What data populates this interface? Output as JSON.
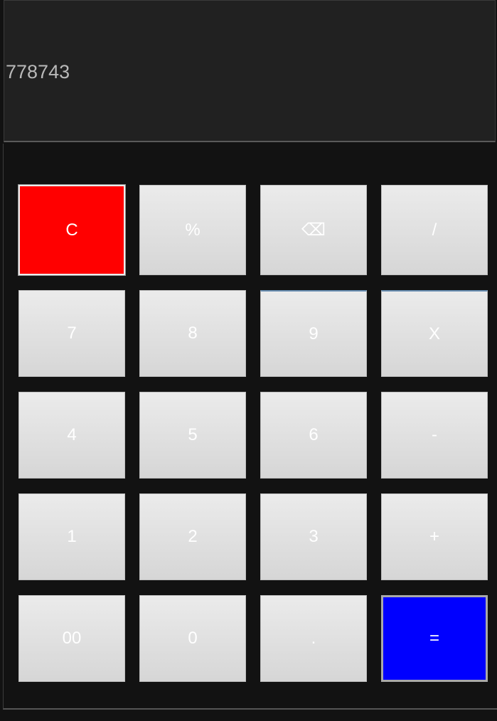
{
  "display": {
    "value": "778743"
  },
  "keys": {
    "clear": "C",
    "percent": "%",
    "backspace": "⌫",
    "divide": "/",
    "seven": "7",
    "eight": "8",
    "nine": "9",
    "multiply": "X",
    "four": "4",
    "five": "5",
    "six": "6",
    "subtract": "-",
    "one": "1",
    "two": "2",
    "three": "3",
    "add": "+",
    "double_zero": "00",
    "zero": "0",
    "decimal": ".",
    "equals": "="
  },
  "colors": {
    "background": "#121212",
    "display_background": "#212121",
    "display_text": "#b9b9b9",
    "key_face": "#e0e0e0",
    "key_text": "#ffffff",
    "clear_key": "#ff0000",
    "equals_key": "#0000ff"
  },
  "icons": {
    "backspace": "backspace-icon"
  }
}
